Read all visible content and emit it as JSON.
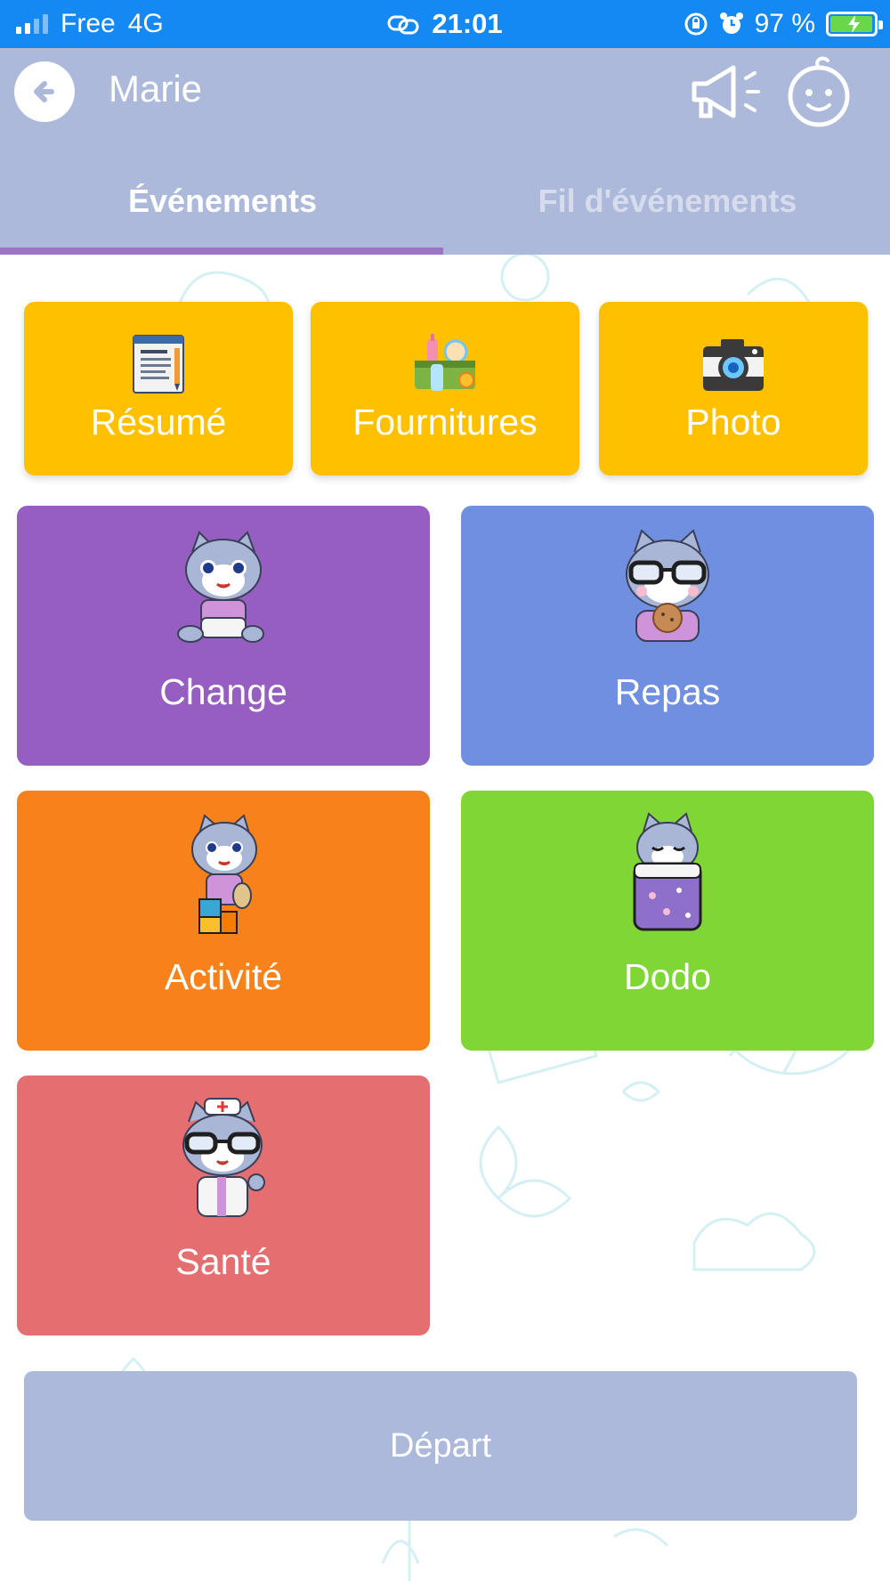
{
  "status_bar": {
    "carrier": "Free",
    "network": "4G",
    "time": "21:01",
    "battery": "97 %",
    "battery_level": 0.97
  },
  "header": {
    "title": "Marie",
    "icons": [
      "back-arrow-icon",
      "megaphone-icon",
      "baby-face-icon"
    ]
  },
  "tabs": [
    {
      "label": "Événements",
      "active": true
    },
    {
      "label": "Fil d'événements",
      "active": false
    }
  ],
  "quick_actions": [
    {
      "label": "Résumé",
      "icon": "document-icon"
    },
    {
      "label": "Fournitures",
      "icon": "supplies-icon"
    },
    {
      "label": "Photo",
      "icon": "camera-icon"
    }
  ],
  "events": [
    {
      "label": "Change",
      "color": "#965ec1",
      "icon": "cat-diaper-icon"
    },
    {
      "label": "Repas",
      "color": "#708fe0",
      "icon": "cat-meal-icon"
    },
    {
      "label": "Activité",
      "color": "#f7821b",
      "icon": "cat-blocks-icon"
    },
    {
      "label": "Dodo",
      "color": "#80d634",
      "icon": "cat-sleep-icon"
    },
    {
      "label": "Santé",
      "color": "#e56e71",
      "icon": "cat-nurse-icon"
    }
  ],
  "depart_button": {
    "label": "Départ"
  },
  "colors": {
    "status_bar": "#1488f3",
    "header": "#adb9db",
    "tab_indicator": "#9b73c9",
    "quick_action": "#ffc000"
  }
}
